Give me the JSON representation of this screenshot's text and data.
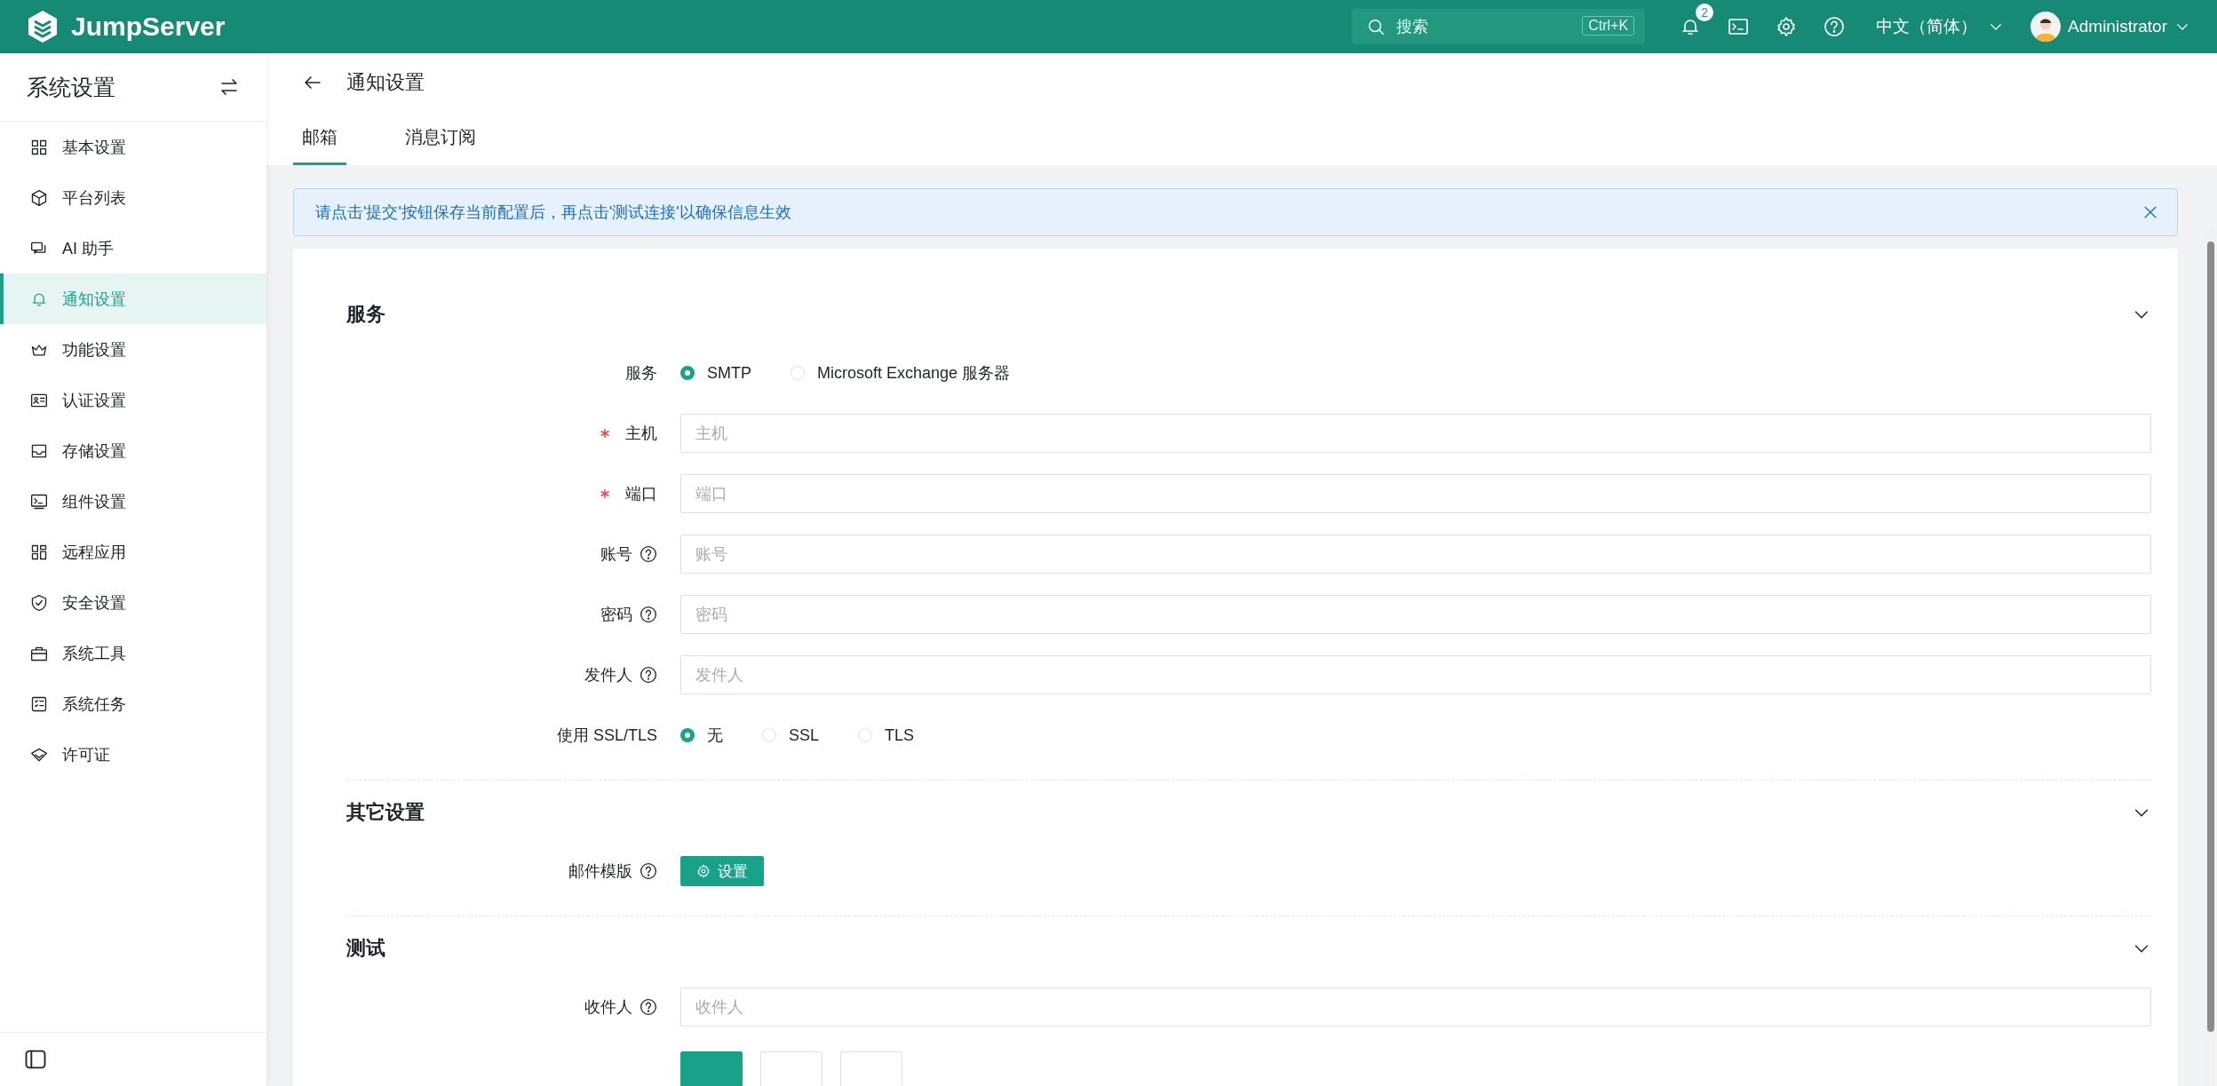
{
  "app": {
    "brand": "JumpServer",
    "search": {
      "placeholder": "搜索",
      "shortcut": "Ctrl+K"
    },
    "notification_count": "2",
    "language": "中文（简体）",
    "user": "Administrator"
  },
  "sidebar": {
    "title": "系统设置",
    "items": [
      {
        "label": "基本设置",
        "selected": false
      },
      {
        "label": "平台列表",
        "selected": false
      },
      {
        "label": "AI 助手",
        "selected": false
      },
      {
        "label": "通知设置",
        "selected": true
      },
      {
        "label": "功能设置",
        "selected": false
      },
      {
        "label": "认证设置",
        "selected": false
      },
      {
        "label": "存储设置",
        "selected": false
      },
      {
        "label": "组件设置",
        "selected": false
      },
      {
        "label": "远程应用",
        "selected": false
      },
      {
        "label": "安全设置",
        "selected": false
      },
      {
        "label": "系统工具",
        "selected": false
      },
      {
        "label": "系统任务",
        "selected": false
      },
      {
        "label": "许可证",
        "selected": false
      }
    ]
  },
  "page": {
    "title": "通知设置",
    "tabs": [
      {
        "label": "邮箱",
        "selected": true
      },
      {
        "label": "消息订阅",
        "selected": false
      }
    ]
  },
  "alert": {
    "message": "请点击'提交'按钮保存当前配置后，再点击'测试连接'以确保信息生效"
  },
  "sections": [
    {
      "title": "服务",
      "expanded": true,
      "fields": [
        {
          "kind": "radio",
          "label": "服务",
          "help": false,
          "options": [
            {
              "label": "SMTP",
              "selected": true
            },
            {
              "label": "Microsoft Exchange 服务器",
              "selected": false
            }
          ]
        },
        {
          "kind": "input",
          "label": "主机",
          "required": true,
          "help": false,
          "placeholder": "主机"
        },
        {
          "kind": "input",
          "label": "端口",
          "required": true,
          "help": false,
          "placeholder": "端口"
        },
        {
          "kind": "input",
          "label": "账号",
          "required": false,
          "help": true,
          "placeholder": "账号"
        },
        {
          "kind": "input",
          "label": "密码",
          "required": false,
          "help": true,
          "placeholder": "密码"
        },
        {
          "kind": "input",
          "label": "发件人",
          "required": false,
          "help": true,
          "placeholder": "发件人"
        },
        {
          "kind": "radio",
          "label": "使用 SSL/TLS",
          "help": false,
          "options": [
            {
              "label": "无",
              "selected": true
            },
            {
              "label": "SSL",
              "selected": false
            },
            {
              "label": "TLS",
              "selected": false
            }
          ]
        }
      ]
    },
    {
      "title": "其它设置",
      "expanded": true,
      "fields": [
        {
          "kind": "button",
          "label": "邮件模版",
          "help": true,
          "button": "设置"
        }
      ]
    },
    {
      "title": "测试",
      "expanded": true,
      "fields": [
        {
          "kind": "input",
          "label": "收件人",
          "required": false,
          "help": true,
          "placeholder": "收件人"
        }
      ]
    }
  ],
  "footer_buttons": [
    {
      "kind": "primary"
    },
    {
      "kind": "default"
    },
    {
      "kind": "default"
    }
  ]
}
